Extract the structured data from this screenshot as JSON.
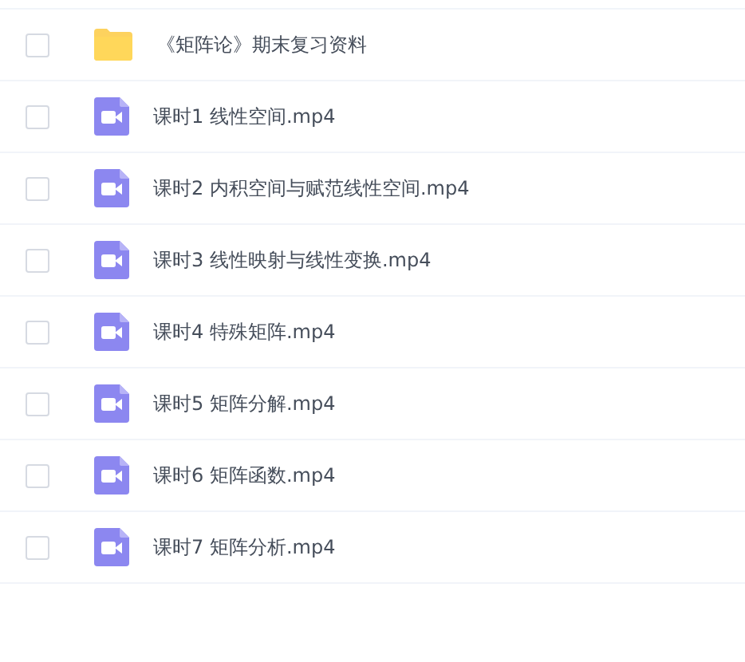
{
  "files": [
    {
      "kind": "folder",
      "name": "《矩阵论》期末复习资料",
      "checked": false
    },
    {
      "kind": "video",
      "name": "课时1 线性空间.mp4",
      "checked": false
    },
    {
      "kind": "video",
      "name": "课时2 内积空间与赋范线性空间.mp4",
      "checked": false
    },
    {
      "kind": "video",
      "name": "课时3 线性映射与线性变换.mp4",
      "checked": false
    },
    {
      "kind": "video",
      "name": "课时4 特殊矩阵.mp4",
      "checked": false
    },
    {
      "kind": "video",
      "name": "课时5 矩阵分解.mp4",
      "checked": false
    },
    {
      "kind": "video",
      "name": "课时6 矩阵函数.mp4",
      "checked": false
    },
    {
      "kind": "video",
      "name": "课时7 矩阵分析.mp4",
      "checked": false
    }
  ]
}
